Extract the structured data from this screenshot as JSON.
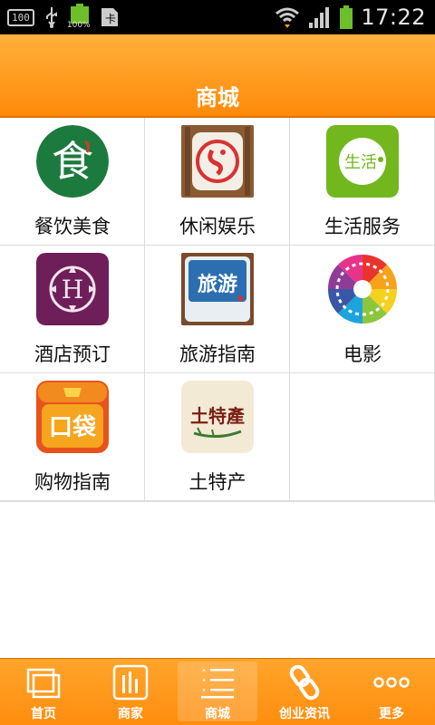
{
  "status_bar": {
    "time": "17:22",
    "badge_left": "100",
    "battery_percent": "100%",
    "battery_level": 1.0
  },
  "header": {
    "title": "商城"
  },
  "grid": {
    "items": [
      {
        "label": "餐饮美食",
        "icon": "food-icon"
      },
      {
        "label": "休闲娱乐",
        "icon": "leisure-icon"
      },
      {
        "label": "生活服务",
        "icon": "life-service-icon"
      },
      {
        "label": "酒店预订",
        "icon": "hotel-icon"
      },
      {
        "label": "旅游指南",
        "icon": "travel-icon"
      },
      {
        "label": "电影",
        "icon": "movie-icon"
      },
      {
        "label": "购物指南",
        "icon": "shopping-icon"
      },
      {
        "label": "土特产",
        "icon": "local-specialty-icon"
      }
    ],
    "icon_text": {
      "food": "食",
      "life": "生活",
      "hotel": "H",
      "travel": "旅游",
      "shopping": "口袋",
      "specialty": "土特產"
    }
  },
  "bottom_nav": {
    "items": [
      {
        "label": "首页",
        "icon": "home-icon"
      },
      {
        "label": "商家",
        "icon": "merchant-icon"
      },
      {
        "label": "商城",
        "icon": "mall-icon",
        "active": true
      },
      {
        "label": "创业资讯",
        "icon": "link-icon"
      },
      {
        "label": "更多",
        "icon": "more-icon"
      }
    ]
  },
  "colors": {
    "accent": "#ff9b1f",
    "nav_bg": "#ff8d0e",
    "divider": "#dcdcdc"
  }
}
